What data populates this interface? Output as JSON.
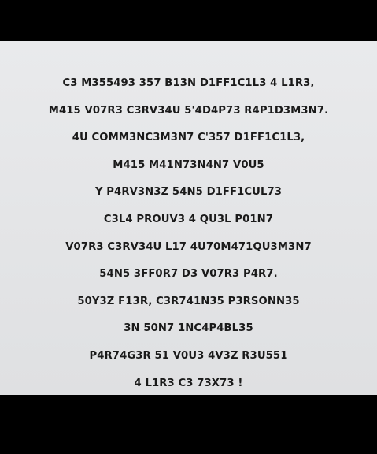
{
  "text_lines": [
    "C3 M355493 357 B13N D1FF1C1L3 4 L1R3,",
    "M415 V07R3 C3RV34U 5'4D4P73 R4P1D3M3N7.",
    "4U COMM3NC3M3N7 C'357 D1FF1C1L3,",
    "M415 M41N73N4N7 V0U5",
    "Y P4RV3N3Z 54N5 D1FF1CUL73",
    "C3L4 PROUV3 4 QU3L P01N7",
    "V07R3 C3RV34U L17 4U70M471QU3M3N7",
    "54N5 3FF0R7 D3 V07R3 P4R7.",
    "50Y3Z F13R, C3R741N35 P3RSONN35",
    "3N 50N7 1NC4P4BL35",
    "P4R74G3R 51 V0U3 4V3Z R3U551",
    "4 L1R3 C3 73X73 !"
  ],
  "colors": {
    "background": "#000000",
    "panel": "#e4e5e7",
    "text": "#1a1a1a"
  }
}
